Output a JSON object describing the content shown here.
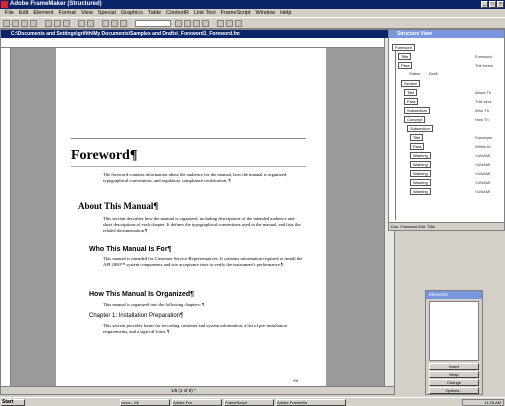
{
  "app": {
    "title": "Adobe FrameMaker (Structured)"
  },
  "menu": [
    "File",
    "Edit",
    "Element",
    "Format",
    "View",
    "Special",
    "Graphics",
    "Table",
    "ContextR",
    "Link Tool",
    "FrameScript",
    "Window",
    "Help"
  ],
  "doc": {
    "path": "C:\\Documents and Settings\\grifith\\My Documents\\Samples and Drafts\\_Foreword1_Foreword.fm",
    "heading": "Foreword¶",
    "foreword_text": "The foreword contains information about the audience for the manual, how the manual is organized, typographical conventions, and regulatory compliance certification. ¶",
    "h_about": "About This Manual¶",
    "about_text": "This section describes how the manual is organized, including descriptions of the intended audience and short descriptions of each chapter. It defines the typographical conventions used in the manual, and lists the related documentation.¶",
    "h_who": "Who This Manual Is For¶",
    "who_text": "This manual is intended for Customer Service Representatives. It contains information required to install the API 2000™ system components and site acceptance tests to verify the instrument's performance.¶",
    "h_how": "How This Manual Is Organized¶",
    "how_text": "This manual is organized into the following chapters: ¶",
    "h_ch1": "Chapter 1: Installation Preparation¶",
    "ch1_text": "This section provides forms for recording customer and system information, a list of pre-installation requirements, and a sign-off form. ¶",
    "page_status": "1/8 (1 of 8) *",
    "page_marker": "VII"
  },
  "structure": {
    "title": "Structure View",
    "status_label": "Status",
    "status_value": "Draft",
    "nodes": [
      "Foreword",
      "Title",
      "Para",
      "Section",
      "Title",
      "Para",
      "Subsection",
      "Concept",
      "Subsection",
      "Title",
      "Para",
      "Warning",
      "Warning",
      "Warning",
      "Warning",
      "Warning"
    ],
    "texts": [
      "Foreword",
      "The forew",
      "About Th",
      "This sect",
      "Who Th",
      "How Th",
      "Conceptu",
      "Within th",
      "<UNAMI",
      "<UNAMI",
      "<UNAMI",
      "<UNAMI",
      "<UNAMI"
    ],
    "footer": "Doc: Foreword   Elm: Title"
  },
  "attrs": {
    "title": "Elements",
    "buttons": [
      "Insert",
      "Wrap",
      "Change",
      "Options..."
    ]
  },
  "taskbar": {
    "start": "Start",
    "tasks": [
      "Inbox - Mi",
      "Adobe Fra",
      "FrameScript",
      "Adobe FrameMa"
    ],
    "time": "11:25 AM"
  }
}
